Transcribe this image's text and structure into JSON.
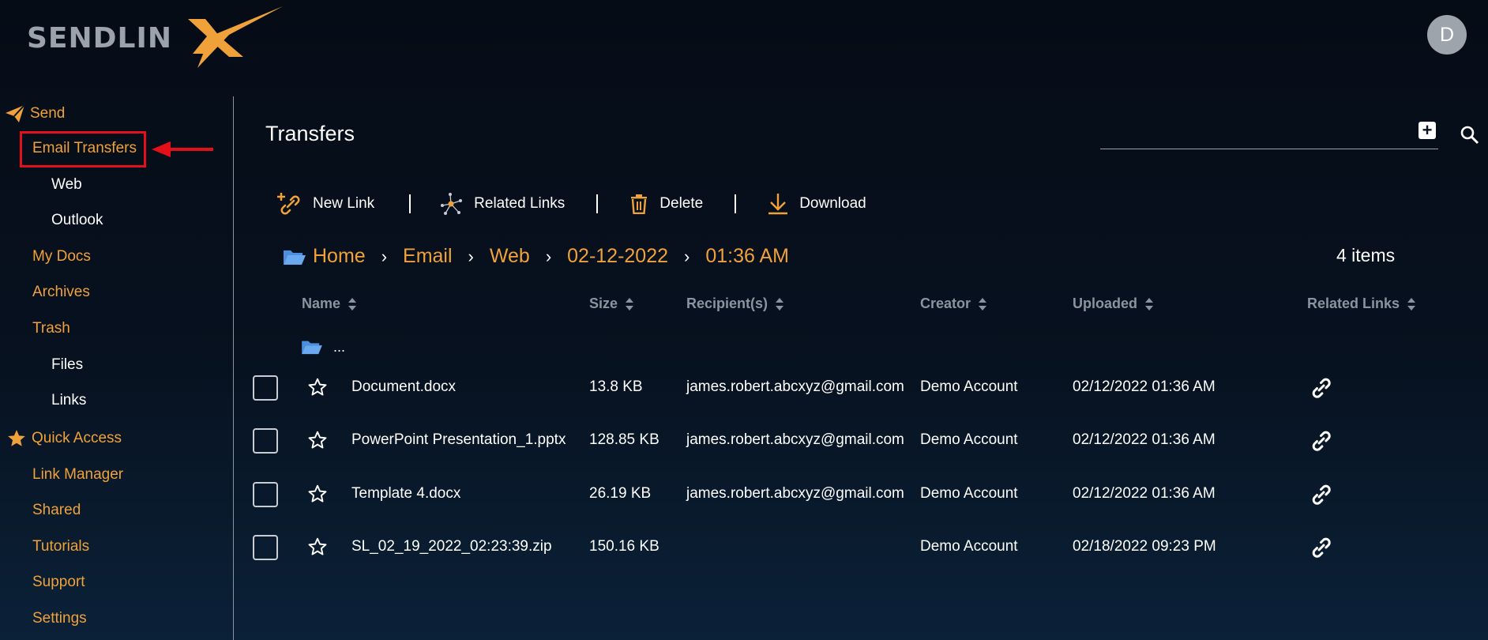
{
  "app": {
    "logo_text": "SENDLIN",
    "avatar_initial": "D"
  },
  "sidebar": {
    "items": [
      {
        "label": "Send",
        "icon": "paper-plane-icon"
      },
      {
        "label": "Email Transfers"
      },
      {
        "label": "Web"
      },
      {
        "label": "Outlook"
      },
      {
        "label": "My Docs"
      },
      {
        "label": "Archives"
      },
      {
        "label": "Trash"
      },
      {
        "label": "Files"
      },
      {
        "label": "Links"
      },
      {
        "label": "Quick Access",
        "icon": "star-filled-icon"
      },
      {
        "label": "Link Manager"
      },
      {
        "label": "Shared"
      },
      {
        "label": "Tutorials"
      },
      {
        "label": "Support"
      },
      {
        "label": "Settings"
      }
    ]
  },
  "main": {
    "title": "Transfers",
    "toolbar": {
      "new_link": "New Link",
      "related_links": "Related Links",
      "delete": "Delete",
      "download": "Download"
    },
    "breadcrumb": [
      "Home",
      "Email",
      "Web",
      "02-12-2022",
      "01:36 AM"
    ],
    "items_count": "4 items",
    "columns": [
      "Name",
      "Size",
      "Recipient(s)",
      "Creator",
      "Uploaded",
      "Related Links"
    ],
    "parent_dir": "...",
    "rows": [
      {
        "name": "Document.docx",
        "size": "13.8 KB",
        "recipient": "james.robert.abcxyz@gmail.com",
        "creator": "Demo Account",
        "uploaded": "02/12/2022 01:36 AM"
      },
      {
        "name": "PowerPoint Presentation_1.pptx",
        "size": "128.85 KB",
        "recipient": "james.robert.abcxyz@gmail.com",
        "creator": "Demo Account",
        "uploaded": "02/12/2022 01:36 AM"
      },
      {
        "name": "Template 4.docx",
        "size": "26.19 KB",
        "recipient": "james.robert.abcxyz@gmail.com",
        "creator": "Demo Account",
        "uploaded": "02/12/2022 01:36 AM"
      },
      {
        "name": "SL_02_19_2022_02:23:39.zip",
        "size": "150.16 KB",
        "recipient": "",
        "creator": "Demo Account",
        "uploaded": "02/18/2022 09:23 PM"
      }
    ]
  },
  "colors": {
    "accent": "#f0a13a",
    "highlight": "#e3101a",
    "background": "#07111f",
    "header_text": "#8b939e"
  }
}
